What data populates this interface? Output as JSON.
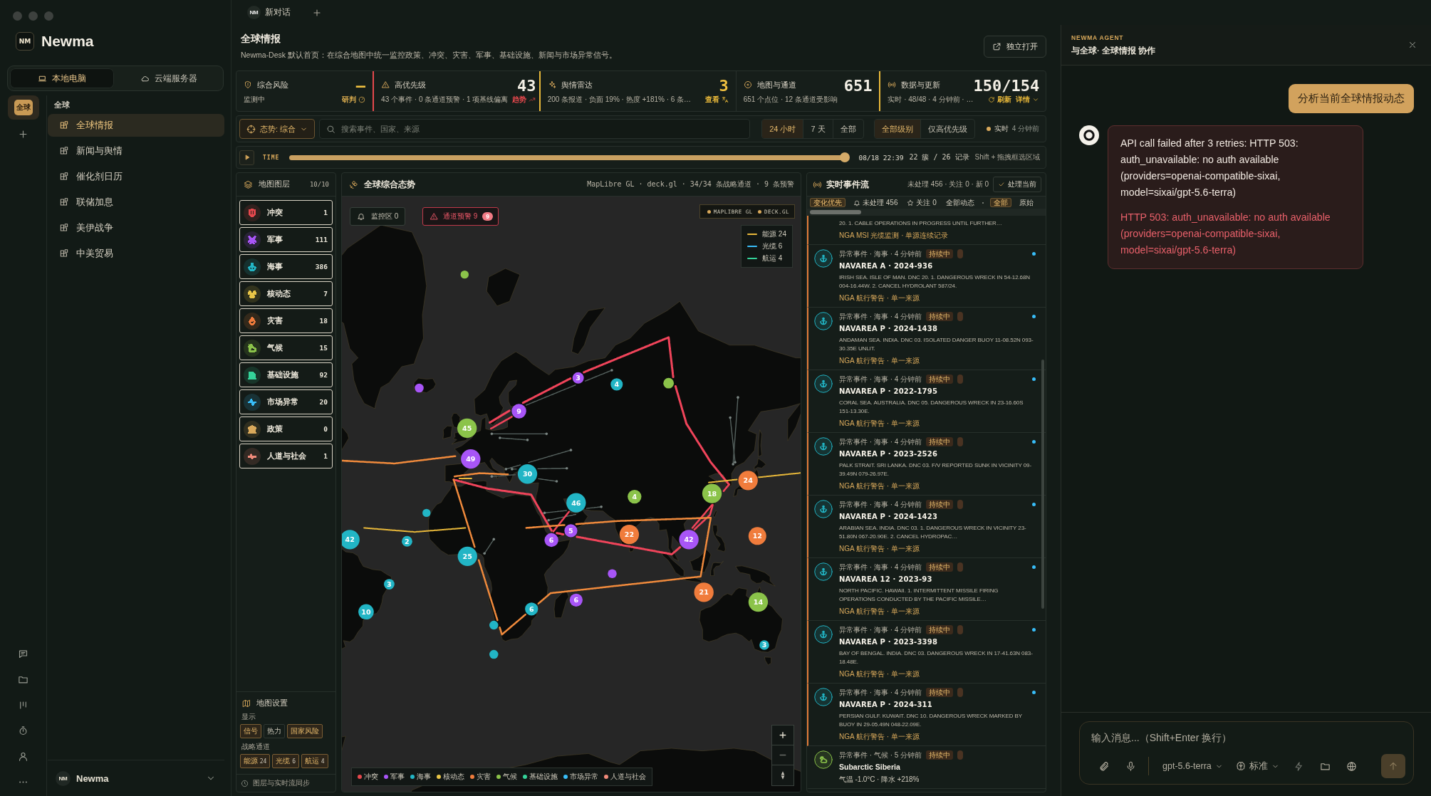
{
  "window": {
    "tabs": [
      {
        "icon_text": "NM",
        "label": "新对话",
        "selected": true
      }
    ]
  },
  "sidebar": {
    "logo": "NM",
    "brand": "Newma",
    "modes": [
      {
        "label": "本地电脑",
        "selected": true
      },
      {
        "label": "云端服务器",
        "selected": false
      }
    ],
    "workspaces": [
      {
        "label": "全球",
        "selected": true
      }
    ],
    "group": "全球",
    "items": [
      {
        "label": "全球情报",
        "selected": true
      },
      {
        "label": "新闻与舆情",
        "selected": false
      },
      {
        "label": "催化剂日历",
        "selected": false
      },
      {
        "label": "联储加息",
        "selected": false
      },
      {
        "label": "美伊战争",
        "selected": false
      },
      {
        "label": "中美贸易",
        "selected": false
      }
    ],
    "user": {
      "avatar": "NM",
      "name": "Newma"
    }
  },
  "header": {
    "title": "全球情报",
    "subtitle": "Newma-Desk 默认首页：在综合地图中统一监控政策、冲突、灾害、军事、基础设施、新闻与市场异常信号。",
    "open_button": "独立打开"
  },
  "stats": [
    {
      "label": "综合风险",
      "value": "—",
      "accent": true,
      "sub": "监测中",
      "actions": [
        {
          "label": "研判"
        }
      ]
    },
    {
      "label": "高优先级",
      "value": "43",
      "accent": false,
      "sub": "43 个事件 · 0 条通道预警 · 1 项基线偏离",
      "color": "#e5484d",
      "actions": [
        {
          "label": "趋势"
        }
      ]
    },
    {
      "label": "舆情雷达",
      "value": "3",
      "accent": true,
      "sub": "200 条报道 · 负面 19% · 热度 +181% · 6 条…",
      "color": "#e8b83a",
      "actions": [
        {
          "label": "查看"
        }
      ]
    },
    {
      "label": "地图与通道",
      "value": "651",
      "accent": false,
      "sub": "651 个点位 · 12 条通道受影响"
    },
    {
      "label": "数据与更新",
      "value": "150/154",
      "accent": false,
      "sub": "实时 · 48/48 · 4 分钟前 · …",
      "color": "#e8b83a",
      "actions": [
        {
          "label": "刷新"
        },
        {
          "label": "详情"
        }
      ]
    }
  ],
  "filters": {
    "posture": "态势: 综合",
    "search_placeholder": "搜索事件、国家、来源",
    "ranges": [
      {
        "label": "24 小时",
        "selected": true
      },
      {
        "label": "7 天",
        "selected": false
      },
      {
        "label": "全部",
        "selected": false
      }
    ],
    "levels": [
      {
        "label": "全部级别",
        "selected": true
      },
      {
        "label": "仅高优先级",
        "selected": false
      }
    ],
    "live": {
      "label": "实时",
      "time": "4 分钟前"
    }
  },
  "timeline": {
    "label": "TIME",
    "level": 1,
    "date": "08/18 22:39",
    "summary": "22 簇 / 26 记录",
    "hint": "Shift + 拖拽框选区域"
  },
  "layers": {
    "title": "地图图层",
    "count": "10/10",
    "items": [
      {
        "label": "冲突",
        "count": "1",
        "color": "#e5484d",
        "on": true
      },
      {
        "label": "军事",
        "count": "111",
        "color": "#a855f7",
        "on": true
      },
      {
        "label": "海事",
        "count": "386",
        "color": "#22b5c5",
        "on": true
      },
      {
        "label": "核动态",
        "count": "7",
        "color": "#e8c547",
        "on": true
      },
      {
        "label": "灾害",
        "count": "18",
        "color": "#f07c3c",
        "on": true
      },
      {
        "label": "气候",
        "count": "15",
        "color": "#8bc34a",
        "on": true
      },
      {
        "label": "基础设施",
        "count": "92",
        "color": "#34d399",
        "on": true
      },
      {
        "label": "市场异常",
        "count": "20",
        "color": "#38bdf8",
        "on": true
      },
      {
        "label": "政策",
        "count": "0",
        "color": "#d9a95b",
        "on": true
      },
      {
        "label": "人道与社会",
        "count": "1",
        "color": "#f08a7a",
        "on": true
      }
    ],
    "settings": {
      "title": "地图设置",
      "display_label": "显示",
      "display": [
        {
          "label": "信号",
          "on": true
        },
        {
          "label": "热力",
          "on": false
        },
        {
          "label": "国家风险",
          "on": true
        }
      ],
      "corridor_label": "战略通道",
      "corridors": [
        {
          "label": "能源",
          "count": "24",
          "on": true
        },
        {
          "label": "光缆",
          "count": "6",
          "on": true
        },
        {
          "label": "航运",
          "count": "4",
          "on": true
        }
      ]
    },
    "footer": "图层与实时流同步"
  },
  "map": {
    "title": "全球综合态势",
    "engine": "MapLibre GL · deck.gl · 34/34 条战略通道 · 9 条预警",
    "watch": "监控区 0",
    "alerts": {
      "label": "通道预警 9",
      "badge": "9"
    },
    "renderers": [
      "MAPLIBRE GL",
      "DECK.GL"
    ],
    "corridor_legend": [
      {
        "label": "能源 24",
        "color": "#e8b83a"
      },
      {
        "label": "光缆 6",
        "color": "#38bdf8"
      },
      {
        "label": "航运 4",
        "color": "#34d399"
      }
    ],
    "marker_groups": [
      {
        "color": "#8bc34a",
        "markers": [
          {
            "kind": "point"
          },
          {
            "kind": "point"
          },
          {
            "kind": "cluster",
            "label": "45"
          },
          {
            "kind": "cluster",
            "label": "4"
          },
          {
            "kind": "cluster",
            "label": "18"
          },
          {
            "kind": "cluster",
            "label": "14"
          }
        ]
      },
      {
        "color": "#a855f7",
        "markers": [
          {
            "kind": "cluster",
            "label": "3"
          },
          {
            "kind": "point"
          },
          {
            "kind": "cluster",
            "label": "9"
          },
          {
            "kind": "cluster",
            "label": "49"
          },
          {
            "kind": "cluster",
            "label": "6"
          },
          {
            "kind": "cluster",
            "label": "5"
          },
          {
            "kind": "cluster",
            "label": "42"
          },
          {
            "kind": "point"
          },
          {
            "kind": "cluster",
            "label": "6"
          }
        ]
      },
      {
        "color": "#22b5c5",
        "markers": [
          {
            "kind": "cluster",
            "label": "4"
          },
          {
            "kind": "cluster",
            "label": "30"
          },
          {
            "kind": "point"
          },
          {
            "kind": "cluster",
            "label": "46"
          },
          {
            "kind": "cluster",
            "label": "42"
          },
          {
            "kind": "cluster",
            "label": "2"
          },
          {
            "kind": "cluster",
            "label": "25"
          },
          {
            "kind": "cluster",
            "label": "3"
          },
          {
            "kind": "cluster",
            "label": "10"
          },
          {
            "kind": "cluster",
            "label": "6"
          },
          {
            "kind": "point"
          },
          {
            "kind": "cluster",
            "label": "3"
          },
          {
            "kind": "point"
          }
        ]
      },
      {
        "color": "#f07c3c",
        "markers": [
          {
            "kind": "cluster",
            "label": "24"
          },
          {
            "kind": "cluster",
            "label": "22"
          },
          {
            "kind": "cluster",
            "label": "12"
          },
          {
            "kind": "cluster",
            "label": "21"
          }
        ]
      }
    ],
    "legend": [
      {
        "label": "冲突",
        "color": "#e5484d"
      },
      {
        "label": "军事",
        "color": "#a855f7"
      },
      {
        "label": "海事",
        "color": "#22b5c5"
      },
      {
        "label": "核动态",
        "color": "#e8c547"
      },
      {
        "label": "灾害",
        "color": "#f07c3c"
      },
      {
        "label": "气候",
        "color": "#8bc34a"
      },
      {
        "label": "基础设施",
        "color": "#34d399"
      },
      {
        "label": "市场异常",
        "color": "#38bdf8"
      },
      {
        "label": "人道与社会",
        "color": "#f08a7a"
      }
    ]
  },
  "events": {
    "title": "实时事件流",
    "summary": "未处理 456 · 关注 0 · 新 0",
    "action": "处理当前",
    "filters": [
      {
        "label": "变化优先",
        "selected": true
      },
      {
        "label": "未处理 456",
        "selected": false
      },
      {
        "label": "关注 0",
        "selected": false
      },
      {
        "label": "全部动态",
        "selected": false
      },
      {
        "label": "全部",
        "selected": true
      },
      {
        "label": "原始",
        "selected": false
      }
    ],
    "items": [
      {
        "body": "20. 1. CABLE OPERATIONS IN PROGRESS UNTIL FURTHER…",
        "source": "NGA MSI 光缆监测 · 单源连续记录",
        "highlighted": true
      },
      {
        "kind": "maritime",
        "meta": "异常事件 · 海事 · 4 分钟前",
        "badge": "持续中",
        "title": "NAVAREA A · 2024-936",
        "body": "IRISH SEA. ISLE OF MAN. DNC 20. 1. DANGEROUS WRECK IN 54-12.68N 004-16.44W. 2. CANCEL HYDROLANT 587/24.",
        "source": "NGA 航行警告 · 单一来源",
        "highlighted": true,
        "unread": true
      },
      {
        "kind": "maritime",
        "meta": "异常事件 · 海事 · 4 分钟前",
        "badge": "持续中",
        "title": "NAVAREA P · 2024-1438",
        "body": "ANDAMAN SEA. INDIA. DNC 03. ISOLATED DANGER BUOY 11-08.52N 093-30.35E UNLIT.",
        "source": "NGA 航行警告 · 单一来源",
        "highlighted": true,
        "unread": true
      },
      {
        "kind": "maritime",
        "meta": "异常事件 · 海事 · 4 分钟前",
        "badge": "持续中",
        "title": "NAVAREA P · 2022-1795",
        "body": "CORAL SEA. AUSTRALIA. DNC 05. DANGEROUS WRECK IN 23-16.60S 151-13.30E.",
        "source": "NGA 航行警告 · 单一来源",
        "highlighted": true,
        "unread": true
      },
      {
        "kind": "maritime",
        "meta": "异常事件 · 海事 · 4 分钟前",
        "badge": "持续中",
        "title": "NAVAREA P · 2023-2526",
        "body": "PALK STRAIT. SRI LANKA. DNC 03. F/V REPORTED SUNK IN VICINITY 09-39.49N 079-26.97E.",
        "source": "NGA 航行警告 · 单一来源",
        "highlighted": true,
        "unread": true
      },
      {
        "kind": "maritime",
        "meta": "异常事件 · 海事 · 4 分钟前",
        "badge": "持续中",
        "title": "NAVAREA P · 2024-1423",
        "body": "ARABIAN SEA. INDIA. DNC 03. 1. DANGEROUS WRECK IN VICINITY 23-51.80N 067-20.90E. 2. CANCEL HYDROPAC…",
        "source": "NGA 航行警告 · 单一来源",
        "highlighted": true,
        "unread": true
      },
      {
        "kind": "maritime",
        "meta": "异常事件 · 海事 · 4 分钟前",
        "badge": "持续中",
        "title": "NAVAREA 12 · 2023-93",
        "body": "NORTH PACIFIC. HAWAII. 1. INTERMITTENT MISSILE FIRING OPERATIONS CONDUCTED BY THE PACIFIC MISSILE…",
        "source": "NGA 航行警告 · 单一来源",
        "highlighted": true,
        "unread": true
      },
      {
        "kind": "maritime",
        "meta": "异常事件 · 海事 · 4 分钟前",
        "badge": "持续中",
        "title": "NAVAREA P · 2023-3398",
        "body": "BAY OF BENGAL. INDIA. DNC 03. DANGEROUS WRECK IN 17-41.63N 083-18.48E.",
        "source": "NGA 航行警告 · 单一来源",
        "highlighted": true,
        "unread": true
      },
      {
        "kind": "maritime",
        "meta": "异常事件 · 海事 · 4 分钟前",
        "badge": "持续中",
        "title": "NAVAREA P · 2024-311",
        "body": "PERSIAN GULF. KUWAIT. DNC 10. DANGEROUS WRECK MARKED BY BUOY IN 29-05.49N 048-22.09E.",
        "source": "NGA 航行警告 · 单一来源",
        "highlighted": true,
        "unread": true
      },
      {
        "kind": "climate",
        "meta": "异常事件 · 气候 · 5 分钟前",
        "badge": "持续中",
        "title": "Subarctic Siberia",
        "body": "气温 -1.0°C · 降水 +218%",
        "highlighted": false,
        "unread": false
      }
    ]
  },
  "chat": {
    "agent_label": "NEWMA AGENT",
    "title": "与全球· 全球情报 协作",
    "messages": [
      {
        "kind": "user",
        "text": "分析当前全球情报动态"
      },
      {
        "kind": "error",
        "text": "API call failed after 3 retries: HTTP 503: auth_unavailable: no auth available (providers=openai-compatible-sixai, model=sixai/gpt-5.6-terra)",
        "detail": "HTTP 503: auth_unavailable: no auth available (providers=openai-compatible-sixai, model=sixai/gpt-5.6-terra)"
      }
    ],
    "input": {
      "placeholder": "输入消息...（Shift+Enter 换行）",
      "model": "gpt-5.6-terra",
      "mode": "标准",
      "send_disabled": true
    }
  }
}
